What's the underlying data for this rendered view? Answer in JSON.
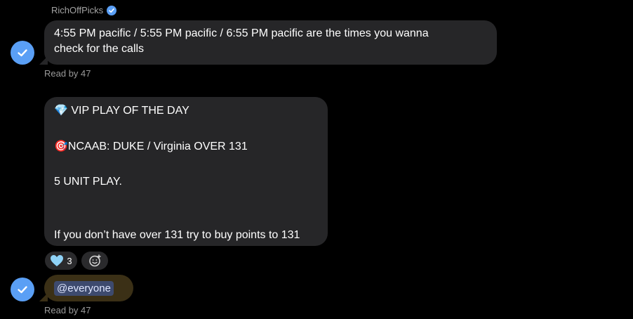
{
  "sender": {
    "name": "RichOffPicks",
    "verified_icon": "verified-check-icon"
  },
  "messages": [
    {
      "lines": [
        "4:55 PM pacific / 5:55 PM pacific / 6:55 PM pacific are the times you wanna",
        "check for the calls"
      ],
      "read_status": "Read by 47"
    },
    {
      "lines": [
        "VIP PLAY OF THE DAY",
        "NCAAB: DUKE / Virginia OVER 131",
        "5 UNIT PLAY.",
        "If you don’t have over 131 try to buy points to 131"
      ],
      "emojis": [
        "💎",
        "🎯"
      ],
      "reactions": [
        {
          "icon": "light-blue-heart-icon",
          "count": "3"
        }
      ],
      "add_reaction_icon": "add-reaction-icon"
    },
    {
      "mention": "@everyone",
      "read_status": "Read by 47"
    }
  ],
  "colors": {
    "background": "#000000",
    "bubble": "#262628",
    "mention_bubble": "#3b3016",
    "mention_tag": "#3d4a6e",
    "verified_blue": "#5a9ff5",
    "secondary_text": "#a3a3a3"
  }
}
